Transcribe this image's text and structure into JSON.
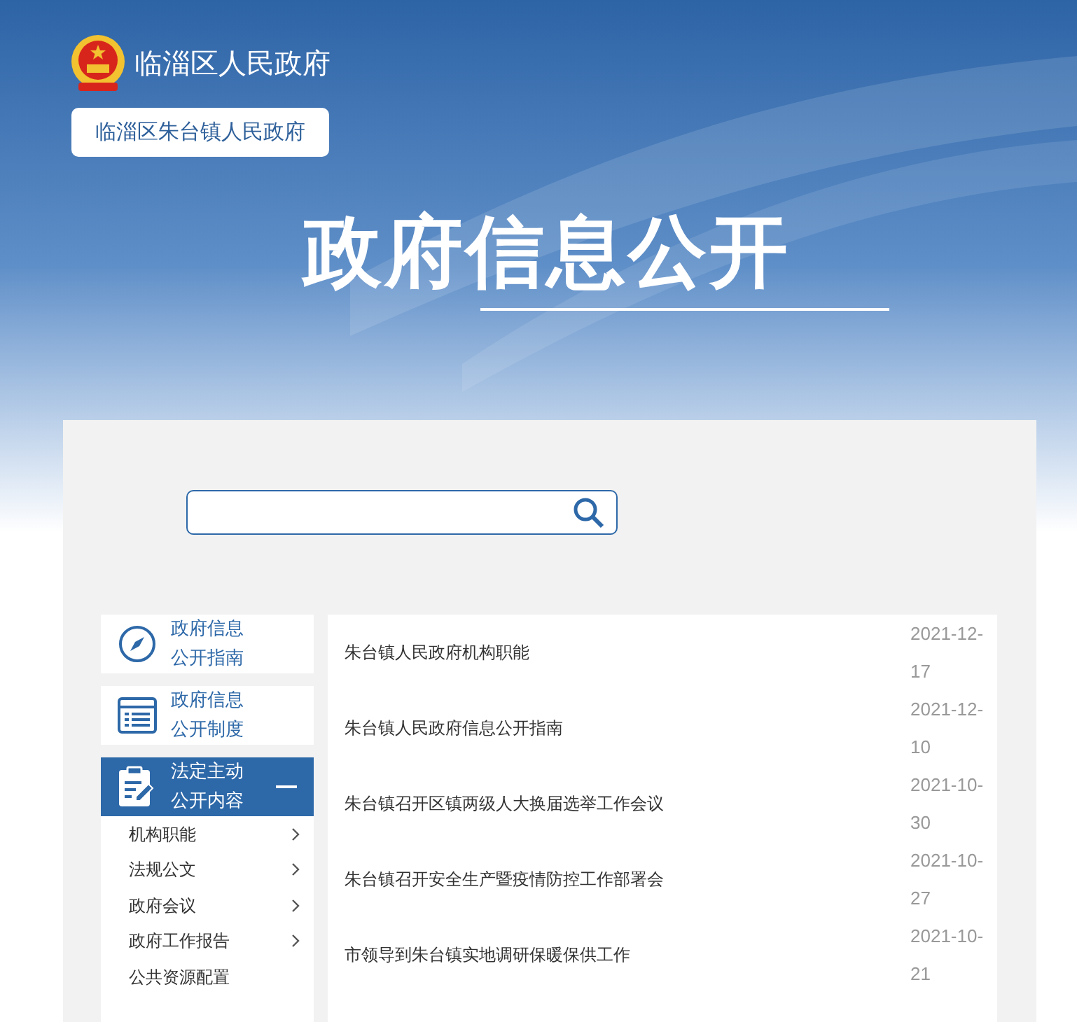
{
  "header": {
    "site_title": "临淄区人民政府",
    "subsite_button": "临淄区朱台镇人民政府",
    "banner_title": "政府信息公开"
  },
  "sidebar": [
    {
      "kind": "guide",
      "label_lines": [
        "政府信息",
        "公开指南"
      ],
      "expanded": false
    },
    {
      "kind": "rules",
      "label_lines": [
        "政府信息",
        "公开制度"
      ],
      "expanded": false
    },
    {
      "kind": "content",
      "label_lines": [
        "法定主动",
        "公开内容"
      ],
      "expanded": true,
      "children": [
        {
          "label": "机构职能",
          "has_arrow": true
        },
        {
          "label": "法规公文",
          "has_arrow": true
        },
        {
          "label": "政府会议",
          "has_arrow": true
        },
        {
          "label": "政府工作报告",
          "has_arrow": true
        },
        {
          "label": "公共资源配置",
          "has_arrow": false
        }
      ]
    }
  ],
  "articles": [
    {
      "title": "朱台镇人民政府机构职能",
      "date": "2021-12-17"
    },
    {
      "title": "朱台镇人民政府信息公开指南",
      "date": "2021-12-10"
    },
    {
      "title": "朱台镇召开区镇两级人大换届选举工作会议",
      "date": "2021-10-30"
    },
    {
      "title": "朱台镇召开安全生产暨疫情防控工作部署会",
      "date": "2021-10-27"
    },
    {
      "title": "市领导到朱台镇实地调研保暖保供工作",
      "date": "2021-10-21"
    }
  ]
}
